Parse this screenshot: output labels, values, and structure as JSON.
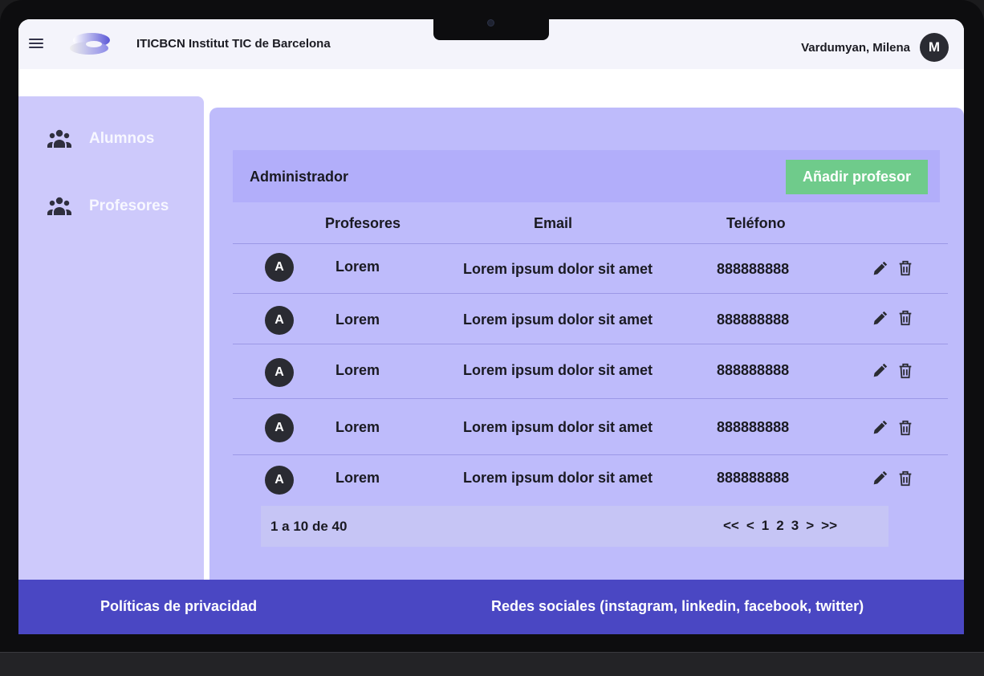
{
  "header": {
    "brand": "ITICBCN Institut TIC de Barcelona",
    "user_name": "Vardumyan, Milena",
    "user_initial": "M"
  },
  "sidebar": {
    "items": [
      {
        "label": "Alumnos",
        "icon": "people-icon"
      },
      {
        "label": "Profesores",
        "icon": "people-icon"
      }
    ]
  },
  "main": {
    "title": "Administrador",
    "add_button_label": "Añadir profesor",
    "columns": [
      "Profesores",
      "Email",
      "Teléfono"
    ],
    "rows": [
      {
        "initial": "A",
        "name": "Lorem",
        "email": "Lorem ipsum dolor sit amet",
        "phone": "888888888"
      },
      {
        "initial": "A",
        "name": "Lorem",
        "email": "Lorem ipsum dolor sit amet",
        "phone": "888888888"
      },
      {
        "initial": "A",
        "name": "Lorem",
        "email": "Lorem ipsum dolor sit amet",
        "phone": "888888888"
      },
      {
        "initial": "A",
        "name": "Lorem",
        "email": "Lorem ipsum dolor sit amet",
        "phone": "888888888"
      },
      {
        "initial": "A",
        "name": "Lorem",
        "email": "Lorem ipsum dolor sit amet",
        "phone": "888888888"
      }
    ],
    "pagination": {
      "summary": "1 a 10 de 40",
      "first": "<<",
      "prev": "<",
      "pages": [
        "1",
        "2",
        "3"
      ],
      "next": ">",
      "last": ">>"
    }
  },
  "footer": {
    "privacy": "Políticas de privacidad",
    "social": "Redes sociales (instagram, linkedin, facebook, twitter)"
  },
  "colors": {
    "sidebar": "#cdc9fb",
    "main": "#bebbfb",
    "admin_bar": "#b2aefa",
    "add_button": "#6fcb8b",
    "footer": "#4a47c3"
  }
}
